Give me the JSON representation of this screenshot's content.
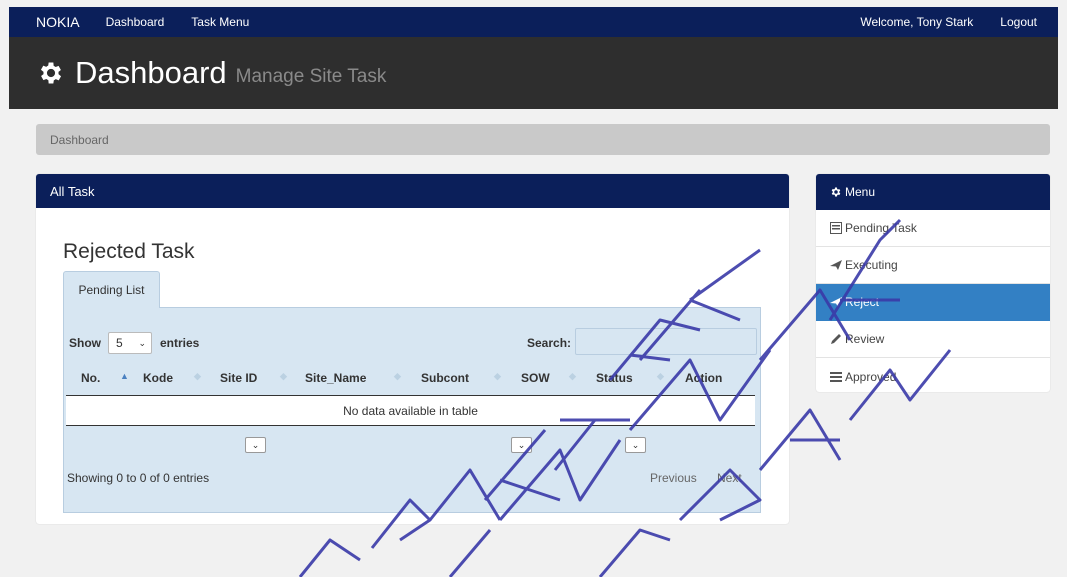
{
  "navbar": {
    "brand": "NOKIA",
    "links": [
      "Dashboard",
      "Task Menu"
    ],
    "welcome": "Welcome, Tony Stark",
    "logout": "Logout"
  },
  "header": {
    "title": "Dashboard",
    "subtitle": "Manage Site Task",
    "icon": "gear-icon"
  },
  "breadcrumb": "Dashboard",
  "panel": {
    "title": "All Task",
    "section_title": "Rejected Task",
    "tab": "Pending List",
    "length": {
      "show": "Show",
      "value": "5",
      "entries": "entries"
    },
    "search_label": "Search:",
    "search_value": "",
    "columns": [
      "No.",
      "Kode",
      "Site ID",
      "Site_Name",
      "Subcont",
      "SOW",
      "Status",
      "Action"
    ],
    "empty_message": "No data available in table",
    "info": "Showing 0 to 0 of 0 entries",
    "previous": "Previous",
    "next": "Next"
  },
  "menu": {
    "title": "Menu",
    "items": [
      {
        "label": "Pending Task",
        "icon": "list-icon",
        "active": false
      },
      {
        "label": "Executing",
        "icon": "plane-icon",
        "active": false
      },
      {
        "label": "Reject",
        "icon": "plane-icon",
        "active": true
      },
      {
        "label": "Review",
        "icon": "pencil-icon",
        "active": false
      },
      {
        "label": "Approved",
        "icon": "list-icon",
        "active": false
      }
    ]
  },
  "watermark": "PRAKTEK INFORMATIKA SURABAYA",
  "colors": {
    "navbar": "#0b1f5a",
    "header": "#2e2e2e",
    "active_menu": "#3380c4",
    "tab_body": "#d7e6f2",
    "watermark": "#3a3aa8"
  }
}
